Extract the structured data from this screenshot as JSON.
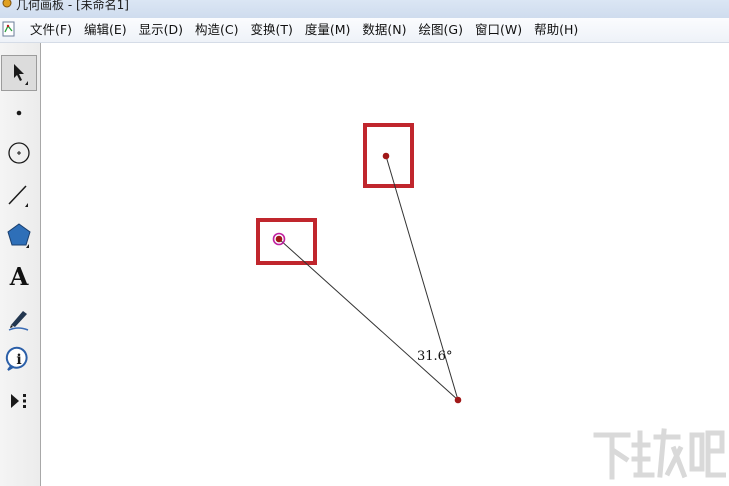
{
  "window": {
    "title": "几何画板 - [未命名1]"
  },
  "menu": {
    "items": [
      "文件(F)",
      "编辑(E)",
      "显示(D)",
      "构造(C)",
      "变换(T)",
      "度量(M)",
      "数据(N)",
      "绘图(G)",
      "窗口(W)",
      "帮助(H)"
    ]
  },
  "toolbox": {
    "tools": [
      {
        "name": "arrow-tool",
        "icon": "arrow-select-icon",
        "selected": true
      },
      {
        "name": "point-tool",
        "icon": "point-icon",
        "selected": false
      },
      {
        "name": "compass-tool",
        "icon": "circle-icon",
        "selected": false
      },
      {
        "name": "straightedge-tool",
        "icon": "line-segment-icon",
        "selected": false
      },
      {
        "name": "polygon-tool",
        "icon": "polygon-icon",
        "selected": false
      },
      {
        "name": "text-tool",
        "icon": "text-a-icon",
        "text": "A",
        "selected": false
      },
      {
        "name": "marker-tool",
        "icon": "marker-pen-icon",
        "selected": false
      },
      {
        "name": "information-tool",
        "icon": "information-icon",
        "text": "i",
        "selected": false
      },
      {
        "name": "custom-tool",
        "icon": "custom-tools-icon",
        "selected": false
      }
    ]
  },
  "canvas": {
    "angle_measure": "31.6°",
    "colors": {
      "point": "#a01818",
      "selected_point_ring": "#c020a0",
      "segment": "#333333",
      "highlight_box": "#c0262d"
    }
  },
  "watermark": {
    "text": "下载吧"
  }
}
